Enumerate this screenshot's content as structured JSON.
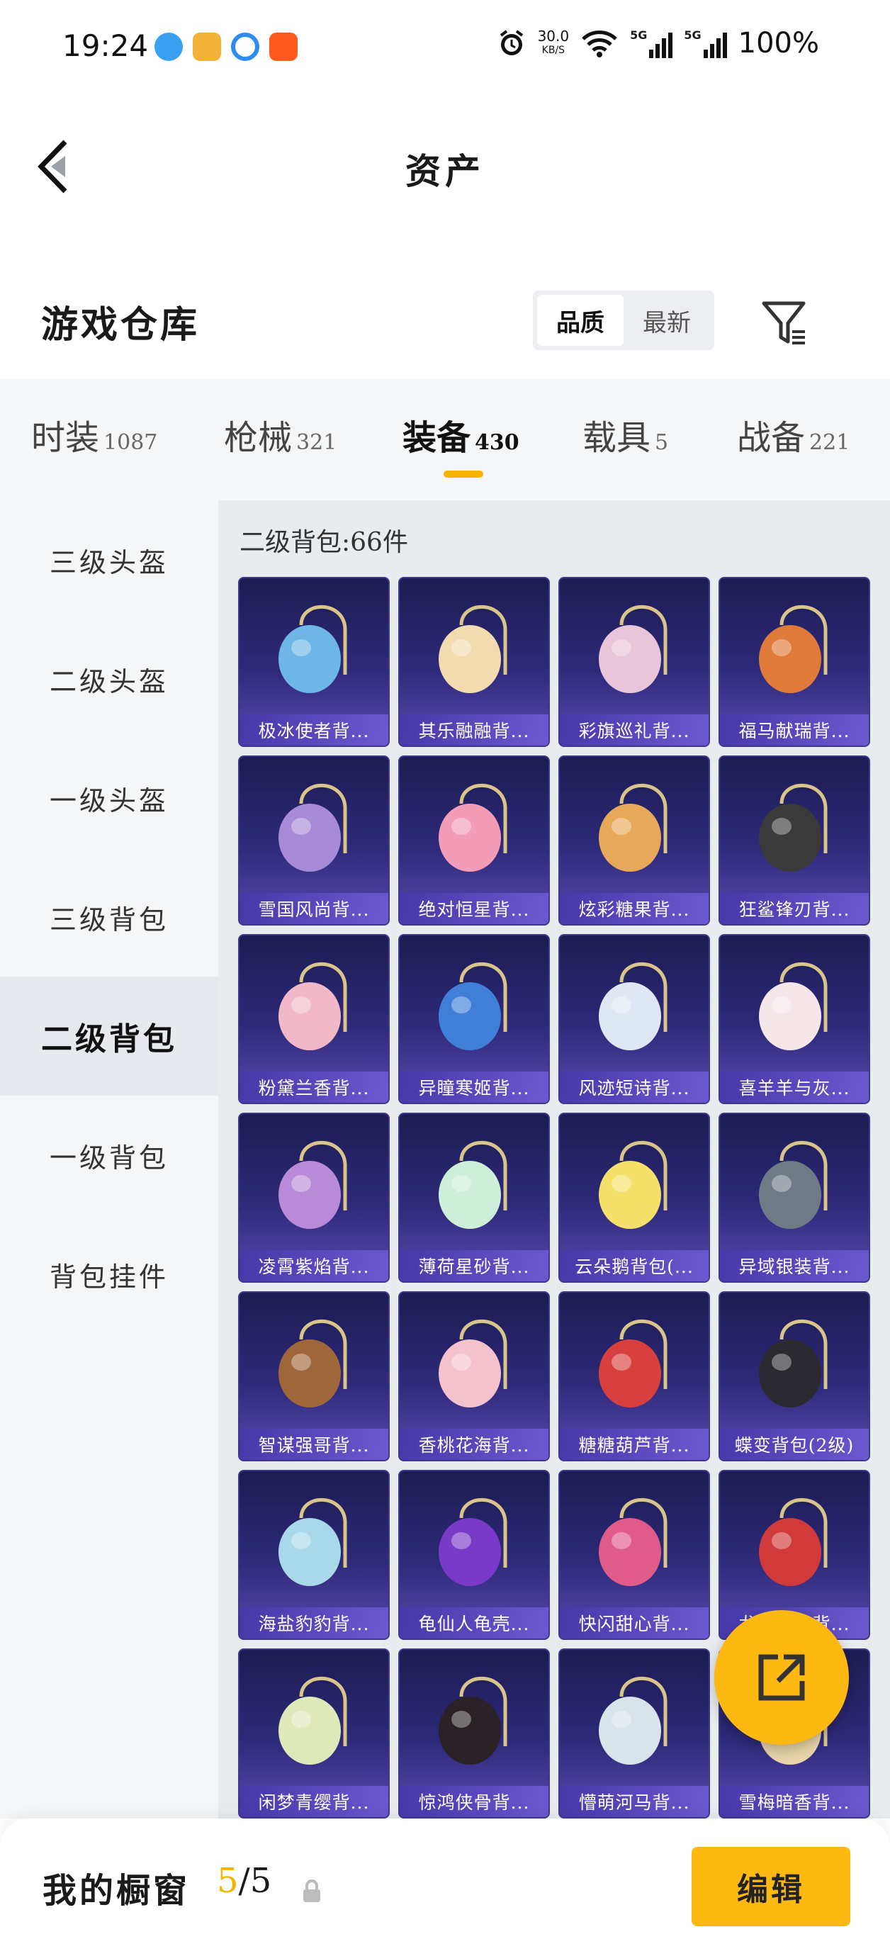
{
  "status_bar": {
    "time": "19:24",
    "net_speed": "30.0",
    "net_unit": "KB/S",
    "network_1": "5G",
    "network_2": "5G",
    "battery": "100%",
    "icons": [
      "qq-browser-icon",
      "music-app-icon",
      "baidu-netdisk-icon",
      "taobao-icon",
      "alarm-icon",
      "wifi-icon",
      "signal-icon",
      "signal-icon"
    ]
  },
  "header": {
    "title": "资产"
  },
  "warehouse": {
    "title": "游戏仓库",
    "sort_options": [
      "品质",
      "最新"
    ],
    "selected_sort": "品质"
  },
  "tabs": [
    {
      "label": "时装",
      "count": "1087"
    },
    {
      "label": "枪械",
      "count": "321"
    },
    {
      "label": "装备",
      "count": "430",
      "active": true
    },
    {
      "label": "载具",
      "count": "5"
    },
    {
      "label": "战备",
      "count": "221"
    }
  ],
  "sidebar": [
    {
      "label": "三级头盔"
    },
    {
      "label": "二级头盔"
    },
    {
      "label": "一级头盔"
    },
    {
      "label": "三级背包"
    },
    {
      "label": "二级背包",
      "active": true
    },
    {
      "label": "一级背包"
    },
    {
      "label": "背包挂件"
    }
  ],
  "category": {
    "title": "二级背包:66件"
  },
  "items": [
    {
      "name": "极冰使者背...",
      "color": "#6fb6e8"
    },
    {
      "name": "其乐融融背...",
      "color": "#f3dbb0"
    },
    {
      "name": "彩旗巡礼背...",
      "color": "#e8c5d8"
    },
    {
      "name": "福马献瑞背...",
      "color": "#e07a3a"
    },
    {
      "name": "雪国风尚背...",
      "color": "#a78bd8"
    },
    {
      "name": "绝对恒星背...",
      "color": "#f29cb8"
    },
    {
      "name": "炫彩糖果背...",
      "color": "#e8a85a"
    },
    {
      "name": "狂鲨锋刃背...",
      "color": "#3a3a3a"
    },
    {
      "name": "粉黛兰香背...",
      "color": "#f0b8c8"
    },
    {
      "name": "异瞳寒姬背...",
      "color": "#3f7fd8"
    },
    {
      "name": "风迹短诗背...",
      "color": "#dfe8f2"
    },
    {
      "name": "喜羊羊与灰...",
      "color": "#f5e6ea"
    },
    {
      "name": "凌霄紫焰背...",
      "color": "#b88ad8"
    },
    {
      "name": "薄荷星砂背...",
      "color": "#cdeed8"
    },
    {
      "name": "云朵鹅背包(...",
      "color": "#f5e06a"
    },
    {
      "name": "异域银装背...",
      "color": "#6f7a86"
    },
    {
      "name": "智谋强哥背...",
      "color": "#a0683a"
    },
    {
      "name": "香桃花海背...",
      "color": "#f4c2cc"
    },
    {
      "name": "糖糖葫芦背...",
      "color": "#d84040"
    },
    {
      "name": "蝶变背包(2级)",
      "color": "#2a2a30"
    },
    {
      "name": "海盐豹豹背...",
      "color": "#a8d8ea"
    },
    {
      "name": "龟仙人龟壳...",
      "color": "#7a3ac8"
    },
    {
      "name": "快闪甜心背...",
      "color": "#e05a8a"
    },
    {
      "name": "龙纹背包背...",
      "color": "#d03a3a"
    },
    {
      "name": "闲梦青缨背...",
      "color": "#dfe8b8"
    },
    {
      "name": "惊鸿侠骨背...",
      "color": "#2a2226"
    },
    {
      "name": "懵萌河马背...",
      "color": "#d8e4ea"
    },
    {
      "name": "雪梅暗香背...",
      "color": "#e8d4a8"
    }
  ],
  "bottom_bar": {
    "label": "我的橱窗",
    "current": "5",
    "total": "/5",
    "edit_label": "编辑"
  },
  "colors": {
    "accent": "#fdb812",
    "card_bg": "#2e2a7a"
  }
}
